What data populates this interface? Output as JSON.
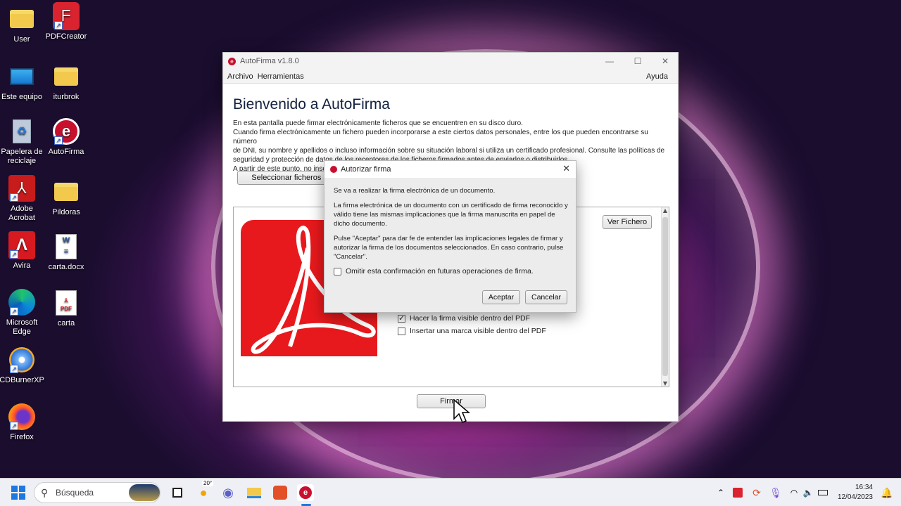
{
  "desktop": {
    "icons": [
      {
        "label": "User",
        "icon": "user-folder-icon"
      },
      {
        "label": "PDFCreator",
        "icon": "pdfcreator-icon"
      },
      {
        "label": "Este equipo",
        "icon": "monitor-icon"
      },
      {
        "label": "iturbrok",
        "icon": "folder-icon"
      },
      {
        "label": "Papelera de reciclaje",
        "icon": "recycle-bin-icon"
      },
      {
        "label": "AutoFirma",
        "icon": "autofirma-icon"
      },
      {
        "label": "Adobe Acrobat",
        "icon": "adobe-acrobat-icon"
      },
      {
        "label": "Pildoras",
        "icon": "folder-icon"
      },
      {
        "label": "Avira",
        "icon": "avira-icon"
      },
      {
        "label": "carta.docx",
        "icon": "word-document-icon"
      },
      {
        "label": "Microsoft Edge",
        "icon": "edge-icon"
      },
      {
        "label": "carta",
        "icon": "pdf-file-icon"
      },
      {
        "label": "CDBurnerXP",
        "icon": "cdburner-icon"
      },
      {
        "label": "Firefox",
        "icon": "firefox-icon"
      }
    ]
  },
  "window": {
    "title": "AutoFirma v1.8.0",
    "menu": {
      "archivo": "Archivo",
      "herramientas": "Herramientas",
      "ayuda": "Ayuda"
    },
    "heading": "Bienvenido a AutoFirma",
    "intro": [
      "En esta pantalla puede firmar electrónicamente ficheros que se encuentren en su disco duro.",
      "Cuando firma electrónicamente un fichero pueden incorporarse a este ciertos datos personales, entre los que pueden encontrarse su número",
      "de DNI, su nombre y apellidos o incluso información sobre su situación laboral si utiliza un certificado profesional. Consulte las políticas de",
      "seguridad y protección de datos de los receptores de los ficheros firmados antes de enviarlos o distribuirlos.",
      "A partir de este punto, no inserte o extraiga ninguna tarjeta inteligente o dispositivo criptográfico USB."
    ],
    "select_button": "Seleccionar ficheros a firmar",
    "view_file_button": "Ver Fichero",
    "check_visible": {
      "label": "Hacer la firma visible dentro del PDF",
      "checked": true
    },
    "check_mark": {
      "label": "Insertar una marca visible dentro del PDF",
      "checked": false
    },
    "sign_button": "Firmar"
  },
  "dialog": {
    "title": "Autorizar firma",
    "p1": "Se va a realizar la firma electrónica de un documento.",
    "p2": "La firma electrónica de un documento con un certificado de firma reconocido y válido tiene las mismas implicaciones que la firma manuscrita en papel de dicho documento.",
    "p3": "Pulse \"Aceptar\" para dar fe de entender las implicaciones legales de firmar y autorizar la firma de los documentos seleccionados. En caso contrario, pulse \"Cancelar\".",
    "omit_check": {
      "label": "Omitir esta confirmación en futuras operaciones de firma.",
      "checked": false
    },
    "accept": "Aceptar",
    "cancel": "Cancelar"
  },
  "taskbar": {
    "search_placeholder": "Búsqueda",
    "weather": "20°",
    "time": "16:34",
    "date": "12/04/2023"
  }
}
